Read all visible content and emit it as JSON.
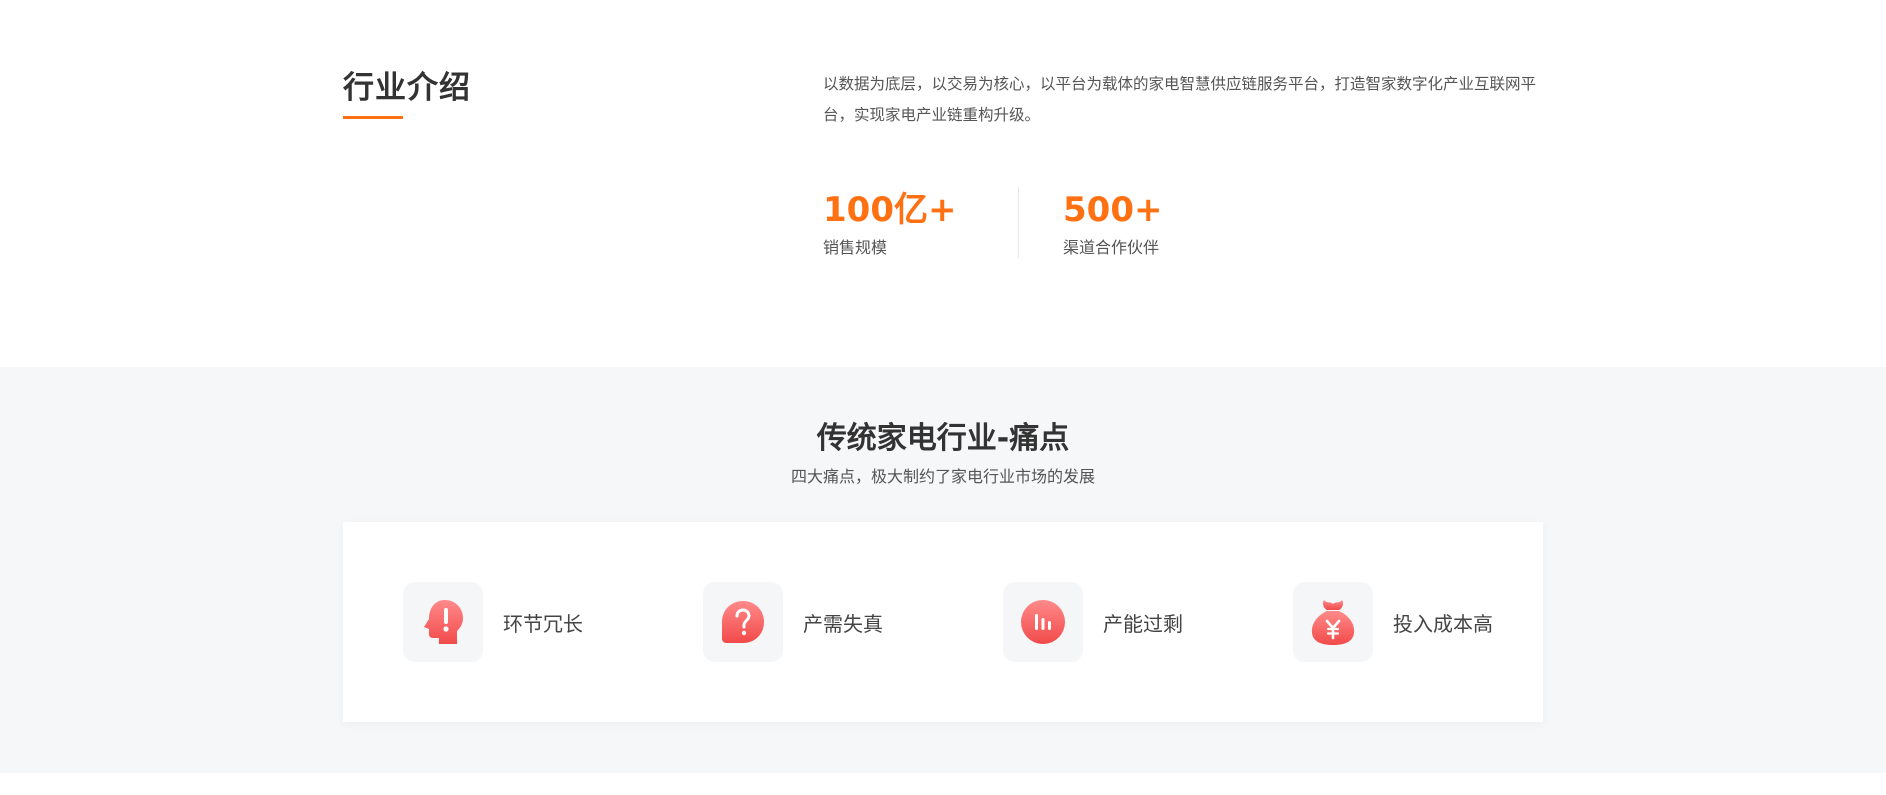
{
  "intro": {
    "title": "行业介绍",
    "description": "以数据为底层，以交易为核心，以平台为载体的家电智慧供应链服务平台，打造智家数字化产业互联网平台，实现家电产业链重构升级。",
    "stats": [
      {
        "value": "100亿+",
        "label": "销售规模"
      },
      {
        "value": "500+",
        "label": "渠道合作伙伴"
      }
    ]
  },
  "pain_points": {
    "title": "传统家电行业-痛点",
    "subtitle": "四大痛点，极大制约了家电行业市场的发展",
    "items": [
      {
        "label": "环节冗长",
        "icon": "head-exclamation-icon"
      },
      {
        "label": "产需失真",
        "icon": "question-bubble-icon"
      },
      {
        "label": "产能过剩",
        "icon": "bar-circle-icon"
      },
      {
        "label": "投入成本高",
        "icon": "money-bag-icon"
      }
    ]
  },
  "colors": {
    "accent": "#ff7012",
    "icon_gradient_start": "#ff8a8a",
    "icon_gradient_end": "#f24a4a",
    "section_bg": "#f6f7f9"
  }
}
